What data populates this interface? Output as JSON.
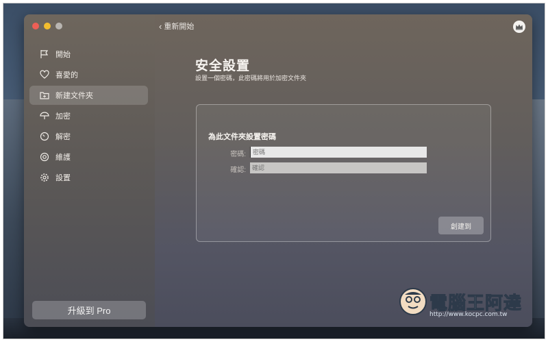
{
  "toolbar": {
    "back_label": "重新開始"
  },
  "sidebar": {
    "items": [
      {
        "label": "開始",
        "icon": "flag-icon"
      },
      {
        "label": "喜愛的",
        "icon": "heart-icon"
      },
      {
        "label": "新建文件夾",
        "icon": "new-folder-icon",
        "active": true
      },
      {
        "label": "加密",
        "icon": "umbrella-icon"
      },
      {
        "label": "解密",
        "icon": "gauge-icon"
      },
      {
        "label": "維護",
        "icon": "lifebuoy-icon"
      },
      {
        "label": "設置",
        "icon": "gear-icon"
      }
    ],
    "upgrade_label": "升級到 Pro"
  },
  "main": {
    "title": "安全設置",
    "subtitle": "設置一個密碼，此密碼將用於加密文件夾",
    "panel": {
      "heading": "為此文件夾設置密碼",
      "password_label": "密碼:",
      "password_placeholder": "密碼",
      "confirm_label": "確認:",
      "confirm_placeholder": "確認",
      "create_label": "創建到"
    }
  },
  "watermark": {
    "text": "電腦王阿達",
    "url": "http://www.kocpc.com.tw"
  },
  "colors": {
    "traffic_red": "#ee5f56",
    "traffic_yellow": "#f3bd2e",
    "traffic_gray": "#b8b5b1"
  }
}
